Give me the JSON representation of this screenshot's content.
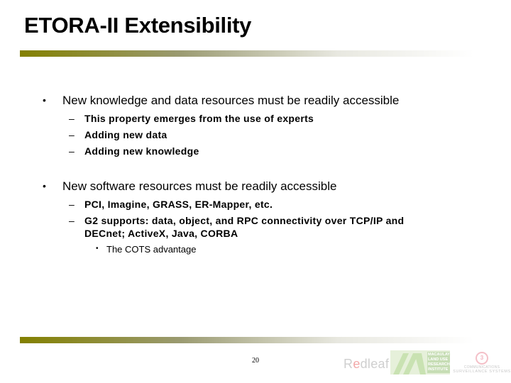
{
  "slide": {
    "title": "ETORA-II Extensibility",
    "page_number": "20",
    "colors": {
      "rule_start": "#838000",
      "rule_mid": "#9a9a70",
      "rule_end": "#ffffff",
      "text": "#000000"
    },
    "bullets": [
      {
        "marker": "•",
        "text": "New knowledge and data resources must be readily accessible",
        "sub": [
          {
            "marker": "–",
            "text": "This property emerges from the use of experts"
          },
          {
            "marker": "–",
            "text": "Adding new data"
          },
          {
            "marker": "–",
            "text": "Adding new knowledge"
          }
        ]
      },
      {
        "marker": "•",
        "text": "New software resources must be readily accessible",
        "sub": [
          {
            "marker": "–",
            "text": "PCI, Imagine, GRASS, ER-Mapper, etc."
          },
          {
            "marker": "–",
            "text": "G2 supports: data, object, and RPC connectivity over TCP/IP and",
            "continuation": "DECnet; ActiveX, Java, CORBA",
            "sub": [
              {
                "marker": "•",
                "text": "The COTS advantage"
              }
            ]
          }
        ]
      }
    ]
  },
  "footer": {
    "logos": {
      "redleaf": {
        "prefix": "R",
        "accent": "e",
        "suffix": "dleaf"
      },
      "macaulay": {
        "text": "MACAULAY LAND USE RESEARCH INSTITUTE"
      },
      "communications_systems": {
        "mark": "3",
        "line1": "COMMUNICATIONS",
        "line2": "SURVEILLANCE SYSTEMS"
      }
    }
  }
}
